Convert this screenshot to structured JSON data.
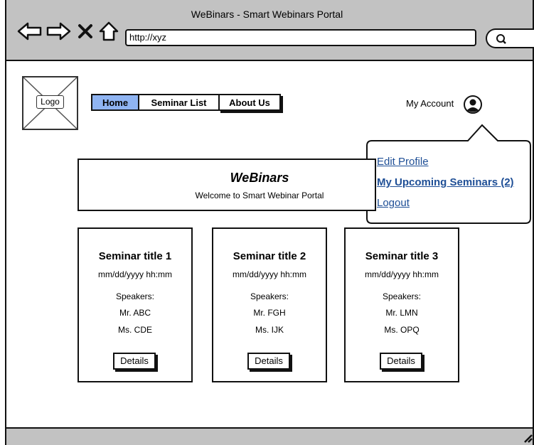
{
  "window": {
    "title": "WeBinars - Smart Webinars Portal"
  },
  "address_bar": {
    "url": "http://xyz"
  },
  "logo": {
    "label": "Logo"
  },
  "nav": {
    "tabs": [
      {
        "label": "Home"
      },
      {
        "label": "Seminar List"
      },
      {
        "label": "About Us"
      }
    ]
  },
  "account": {
    "label": "My Account"
  },
  "account_menu": {
    "items": [
      {
        "label": "Edit Profile"
      },
      {
        "label": "My Upcoming Seminars (2)"
      },
      {
        "label": "Logout"
      }
    ]
  },
  "banner": {
    "title": "WeBinars",
    "subtitle": "Welcome to Smart Webinar Portal"
  },
  "seminars": [
    {
      "title": "Seminar title 1",
      "datetime": "mm/dd/yyyy hh:mm",
      "speakers_label": "Speakers:",
      "speakers": [
        "Mr. ABC",
        "Ms. CDE"
      ],
      "button": "Details"
    },
    {
      "title": "Seminar title 2",
      "datetime": "mm/dd/yyyy hh:mm",
      "speakers_label": "Speakers:",
      "speakers": [
        "Mr. FGH",
        "Ms. IJK"
      ],
      "button": "Details"
    },
    {
      "title": "Seminar title 3",
      "datetime": "mm/dd/yyyy hh:mm",
      "speakers_label": "Speakers:",
      "speakers": [
        "Mr. LMN",
        "Ms. OPQ"
      ],
      "button": "Details"
    }
  ]
}
